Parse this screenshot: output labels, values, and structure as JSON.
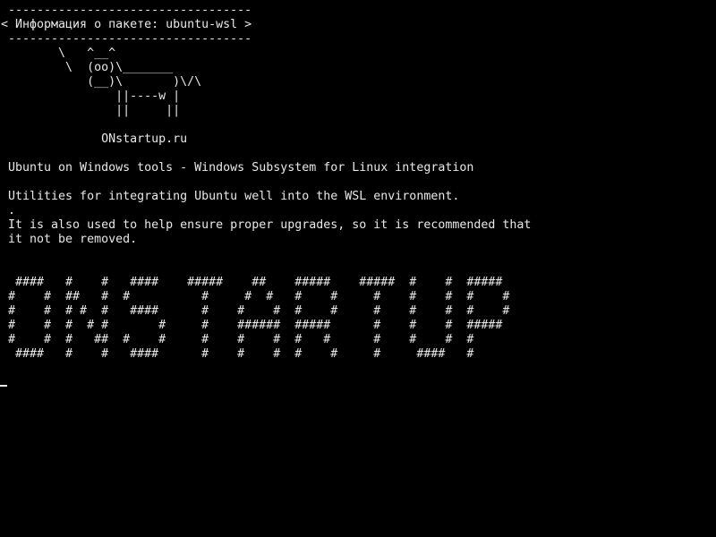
{
  "theme": {
    "background": "#000000",
    "foreground": "#e8e8e8"
  },
  "terminal": {
    "lines": [
      " ----------------------------------",
      "< Информация о пакете: ubuntu-wsl >",
      " ----------------------------------",
      "        \\   ^__^",
      "         \\  (oo)\\_______",
      "            (__)\\       )\\/\\",
      "                ||----w |",
      "                ||     ||",
      "",
      "              ONstartup.ru",
      "",
      " Ubuntu on Windows tools - Windows Subsystem for Linux integration",
      "",
      " Utilities for integrating Ubuntu well into the WSL environment.",
      " .",
      " It is also used to help ensure proper upgrades, so it is recommended that",
      " it not be removed.",
      "",
      "",
      "  ####   #    #   ####    #####    ##    #####    #####  #    #  #####",
      " #    #  ##   #  #          #     #  #   #    #     #    #    #  #    #",
      " #    #  # #  #   ####      #    #    #  #    #     #    #    #  #    #",
      " #    #  #  # #       #     #    ######  #####      #    #    #  #####",
      " #    #  #   ##  #    #     #    #    #  #   #      #    #    #  #",
      "  ####   #    #   ####      #    #    #  #    #     #     ####   #"
    ]
  }
}
